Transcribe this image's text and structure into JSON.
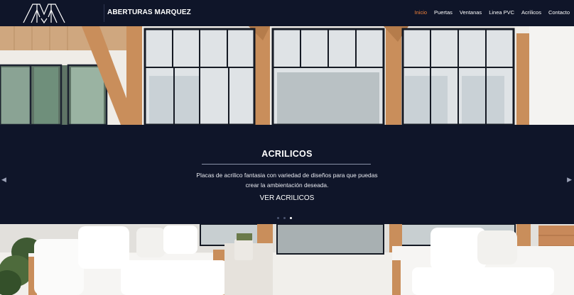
{
  "brand": {
    "name": "ABERTURAS MARQUEZ",
    "logo_icon": "am-monogram-logo"
  },
  "nav": {
    "items": [
      {
        "label": "Inicio",
        "active": true
      },
      {
        "label": "Puertas",
        "active": false
      },
      {
        "label": "Ventanas",
        "active": false
      },
      {
        "label": "Linea PVC",
        "active": false
      },
      {
        "label": "Acrilicos",
        "active": false
      },
      {
        "label": "Contacto",
        "active": false
      }
    ]
  },
  "slide": {
    "title": "ACRILICOS",
    "description": "Placas de acrilico fantasia con variedad de diseños para que puedas crear la ambientación deseada.",
    "link_label": "VER ACRILICOS",
    "indicators": [
      false,
      false,
      true
    ],
    "prev_icon": "chevron-left-icon",
    "next_icon": "chevron-right-icon"
  },
  "colors": {
    "header_bg": "#0f1529",
    "accent": "#f0813a",
    "band_bg": "#0f1529"
  }
}
